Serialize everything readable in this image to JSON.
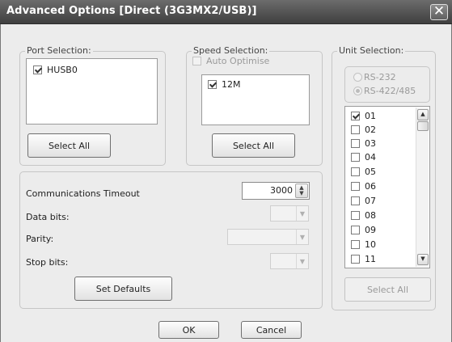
{
  "window": {
    "title": "Advanced Options [Direct (3G3MX2/USB)]",
    "close_glyph": "✕"
  },
  "port_selection": {
    "legend": "Port Selection:",
    "items": [
      {
        "label": "HUSB0",
        "checked": true
      }
    ],
    "select_all_label": "Select All"
  },
  "speed_selection": {
    "legend": "Speed Selection:",
    "auto_optimise_label": "Auto Optimise",
    "auto_optimise_checked": false,
    "items": [
      {
        "label": "12M",
        "checked": true
      }
    ],
    "select_all_label": "Select All"
  },
  "comm_settings": {
    "timeout_label": "Communications Timeout",
    "timeout_value": "3000",
    "data_bits_label": "Data bits:",
    "data_bits_value": "",
    "parity_label": "Parity:",
    "parity_value": "",
    "stop_bits_label": "Stop bits:",
    "stop_bits_value": "",
    "set_defaults_label": "Set Defaults"
  },
  "unit_selection": {
    "legend": "Unit Selection:",
    "radio_rs232_label": "RS-232",
    "radio_rs422_label": "RS-422/485",
    "selected_radio": "RS-422/485",
    "units": [
      {
        "label": "01",
        "checked": true
      },
      {
        "label": "02",
        "checked": false
      },
      {
        "label": "03",
        "checked": false
      },
      {
        "label": "04",
        "checked": false
      },
      {
        "label": "05",
        "checked": false
      },
      {
        "label": "06",
        "checked": false
      },
      {
        "label": "07",
        "checked": false
      },
      {
        "label": "08",
        "checked": false
      },
      {
        "label": "09",
        "checked": false
      },
      {
        "label": "10",
        "checked": false
      },
      {
        "label": "11",
        "checked": false
      }
    ],
    "select_all_label": "Select All"
  },
  "footer": {
    "ok_label": "OK",
    "cancel_label": "Cancel"
  },
  "icons": {
    "close": "close-icon",
    "checkbox_checked": "checkbox-checked-icon",
    "spin_up": "up-arrow-icon",
    "spin_down": "down-arrow-icon",
    "combo_arrow": "chevron-down-icon",
    "scroll_up": "scroll-up-icon",
    "scroll_down": "scroll-down-icon"
  },
  "colors": {
    "titlebar": "#4f4f4f",
    "dialog_bg": "#ececec",
    "disabled_text": "#9a9a9a"
  }
}
